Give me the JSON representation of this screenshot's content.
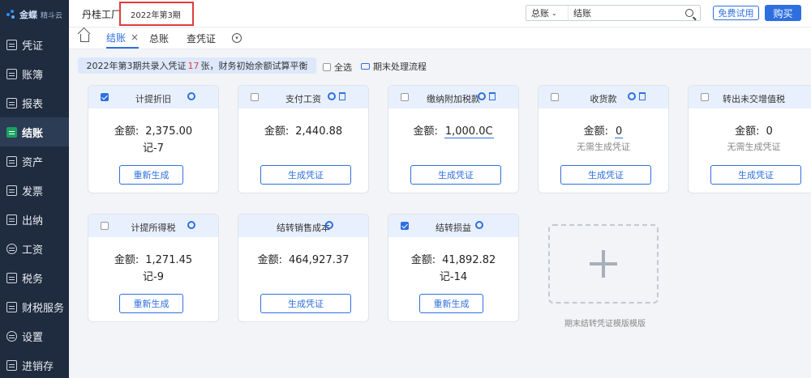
{
  "app": {
    "logo_name": "金蝶",
    "logo_sub": "精斗云"
  },
  "sidebar": {
    "items": [
      {
        "label": "凭证",
        "icon": "doc-icon"
      },
      {
        "label": "账簿",
        "icon": "book-icon"
      },
      {
        "label": "报表",
        "icon": "report-icon"
      },
      {
        "label": "结账",
        "icon": "closing-icon",
        "active": true
      },
      {
        "label": "资产",
        "icon": "asset-icon"
      },
      {
        "label": "发票",
        "icon": "invoice-icon"
      },
      {
        "label": "出纳",
        "icon": "cashier-icon"
      },
      {
        "label": "工资",
        "icon": "salary-icon"
      },
      {
        "label": "税务",
        "icon": "tax-icon"
      },
      {
        "label": "财税服务",
        "icon": "service-icon"
      },
      {
        "label": "设置",
        "icon": "settings-icon"
      },
      {
        "label": "进销存",
        "icon": "inventory-icon"
      }
    ]
  },
  "header": {
    "company": "丹桂工厂",
    "period": "2022年第3期",
    "search_scope": "总账",
    "search_value": "结账",
    "trial_label": "免费试用",
    "buy_label": "购买"
  },
  "tabs": [
    {
      "label": "结账",
      "active": true
    },
    {
      "label": "总账"
    },
    {
      "label": "查凭证"
    }
  ],
  "info": {
    "prefix": "2022年第3期共录入凭证",
    "count": "17",
    "suffix": "张，财务初始余额试算平衡"
  },
  "select_all_label": "全选",
  "flow_label": "期末处理流程",
  "amount_label": "金额:",
  "cards": [
    {
      "title": "计提折旧",
      "checked": true,
      "amount": "2,375.00",
      "sub": "记-7",
      "button": "重新生成"
    },
    {
      "title": "支付工资",
      "checked": false,
      "amount": "2,440.88",
      "sub": "",
      "button": "生成凭证"
    },
    {
      "title": "缴纳附加税款",
      "checked": false,
      "amount": "1,000.0C",
      "sub": "",
      "button": "生成凭证"
    },
    {
      "title": "收货款",
      "checked": false,
      "amount": "0",
      "sub": "无需生成凭证",
      "button": "生成凭证"
    },
    {
      "title": "转出未交增值税",
      "checked": false,
      "amount": "0",
      "sub": "无需生成凭证",
      "button": "生成凭证"
    },
    {
      "title": "计提所得税",
      "checked": false,
      "amount": "1,271.45",
      "sub": "记-9",
      "button": "重新生成"
    },
    {
      "title": "结转销售成本",
      "checked": false,
      "amount": "464,927.37",
      "sub": "",
      "button": "生成凭证"
    },
    {
      "title": "结转损益",
      "checked": true,
      "amount": "41,892.82",
      "sub": "记-14",
      "button": "重新生成"
    }
  ],
  "add_template_label": "期末结转凭证模版模版"
}
